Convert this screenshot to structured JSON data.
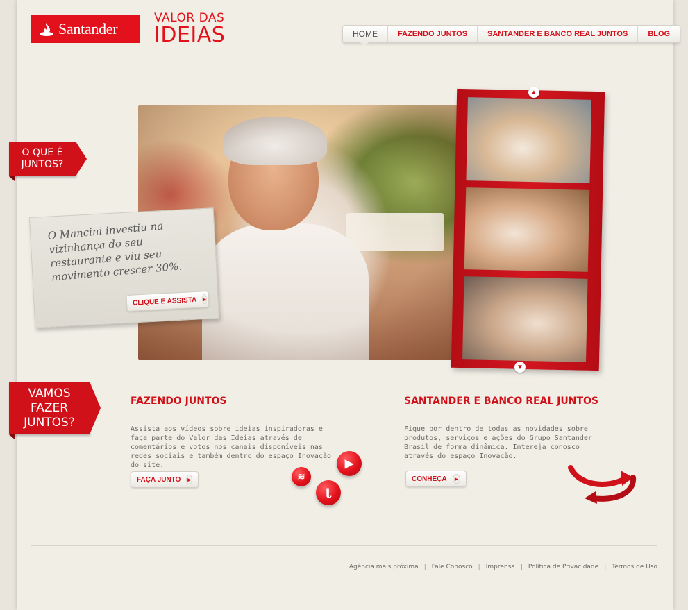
{
  "brand": {
    "logo_text": "Santander",
    "tagline_line1": "VALOR DAS",
    "tagline_line2": "IDEIAS",
    "red": "#e3111b"
  },
  "nav": {
    "items": [
      {
        "label": "HOME",
        "active": true
      },
      {
        "label": "FAZENDO JUNTOS"
      },
      {
        "label": "SANTANDER E BANCO REAL JUNTOS"
      },
      {
        "label": "BLOG"
      }
    ]
  },
  "ribbons": {
    "first": [
      "O QUE É",
      "JUNTOS?"
    ],
    "second": [
      "VAMOS",
      "FAZER",
      "JUNTOS?"
    ]
  },
  "hero": {
    "quote": "O Mancini investiu na vizinhança do seu restaurante e viu seu movimento crescer 30%.",
    "cta_label": "CLIQUE E ASSISTA",
    "strip_icons": [
      "chevron-up-icon",
      "chevron-down-icon"
    ]
  },
  "sections": {
    "fazendo": {
      "title": "FAZENDO JUNTOS",
      "body": "Assista aos vídeos sobre ideias inspiradoras e faça parte do Valor das Ideias através de comentários e votos nos canais disponíveis nas redes sociais e também dentro do espaço Inovação do site.",
      "button_label": "FAÇA JUNTO"
    },
    "santander": {
      "title": "SANTANDER E BANCO REAL JUNTOS",
      "body": "Fique por dentro de todas as novidades sobre produtos, serviços e ações do Grupo Santander Brasil de forma dinâmica. Intereja conosco através do espaço Inovação.",
      "button_label": "CONHEÇA"
    }
  },
  "social_icons": [
    "rss-icon",
    "play-icon",
    "twitter-icon"
  ],
  "footer": {
    "links": [
      "Agência mais próxima",
      "Fale Conosco",
      "Imprensa",
      "Política de Privacidade",
      "Termos de Uso"
    ],
    "separator": "|"
  }
}
